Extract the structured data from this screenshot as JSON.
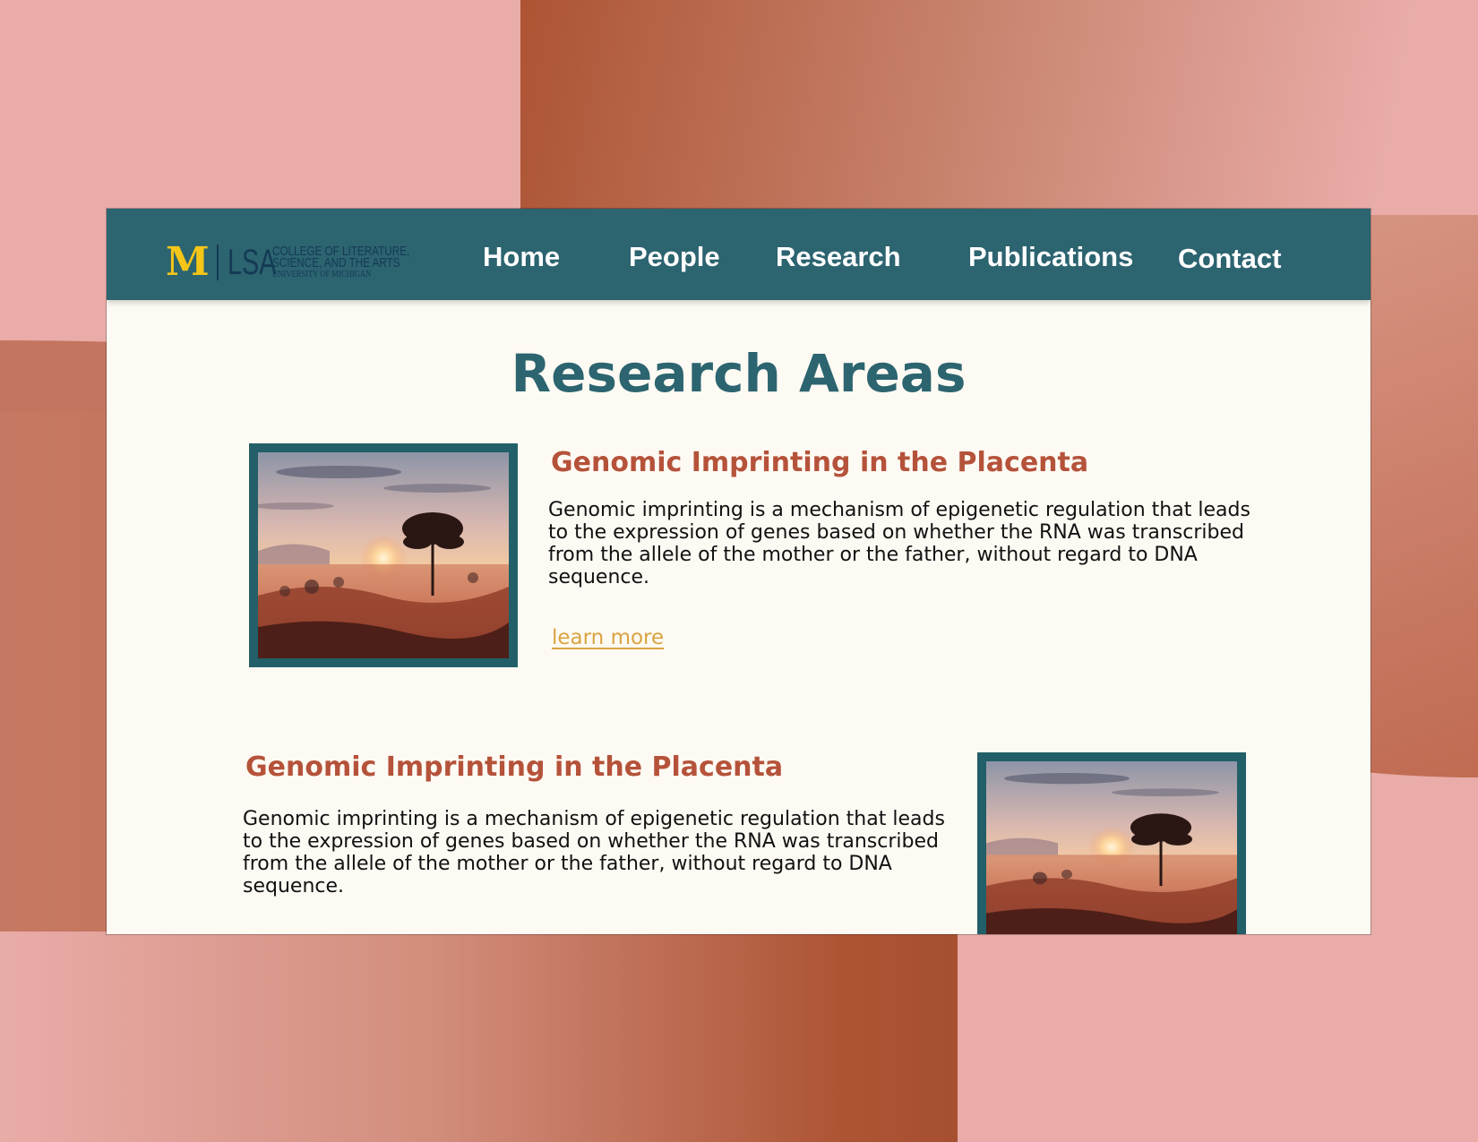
{
  "logo": {
    "mark": "M",
    "unit": "LSA",
    "line1": "COLLEGE OF LITERATURE,",
    "line2": "SCIENCE, AND THE ARTS",
    "line3": "UNIVERSITY OF MICHIGAN"
  },
  "nav": {
    "items": [
      {
        "label": "Home"
      },
      {
        "label": "People"
      },
      {
        "label": "Research"
      },
      {
        "label": "Publications"
      },
      {
        "label": "Contact"
      }
    ]
  },
  "page": {
    "title": "Research Areas"
  },
  "areas": [
    {
      "title": "Genomic Imprinting in the Placenta",
      "description": "Genomic imprinting is a mechanism of epigenetic regulation that leads to the expression of genes based on whether the RNA was transcribed from the allele of the mother or the father, without regard to DNA sequence.",
      "link": "learn more"
    },
    {
      "title": "Genomic Imprinting in the Placenta",
      "description": "Genomic imprinting is a mechanism of epigenetic regulation that leads to the expression of genes based on whether the RNA was transcribed from the allele of the mother or the father, without regard to DNA sequence."
    }
  ],
  "colors": {
    "nav_bg": "#2c6470",
    "title": "#2c6470",
    "area_title": "#b5523a",
    "link": "#d9a441",
    "logo_mark": "#f5c518",
    "page_bg": "#fdfaf3",
    "backdrop": "#e9aca8"
  }
}
